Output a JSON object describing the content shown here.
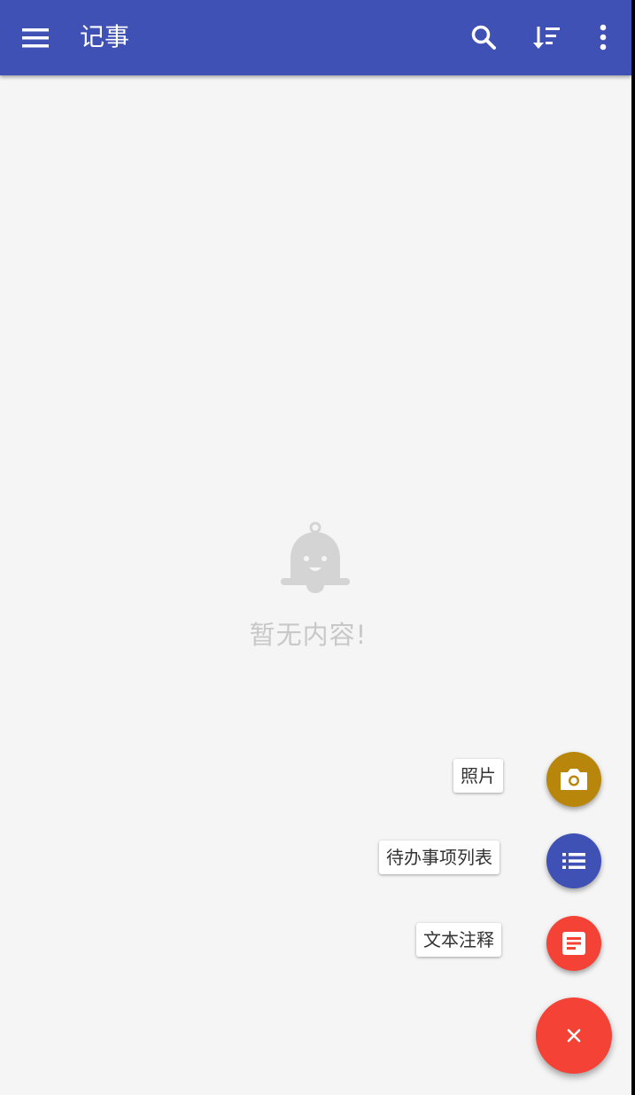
{
  "appbar": {
    "title": "记事",
    "nav_icon": "menu-icon",
    "actions": [
      "search-icon",
      "sort-icon",
      "more-vert-icon"
    ],
    "color": "#3f51b5"
  },
  "empty_state": {
    "icon": "bell-icon",
    "message": "暂无内容!"
  },
  "fab_menu": {
    "items": [
      {
        "label": "照片",
        "icon": "camera-icon",
        "color": "#b8860b"
      },
      {
        "label": "待办事项列表",
        "icon": "list-icon",
        "color": "#3f51b5"
      },
      {
        "label": "文本注释",
        "icon": "note-icon",
        "color": "#f44336"
      }
    ],
    "main": {
      "icon": "close-icon",
      "color": "#f44336"
    }
  }
}
